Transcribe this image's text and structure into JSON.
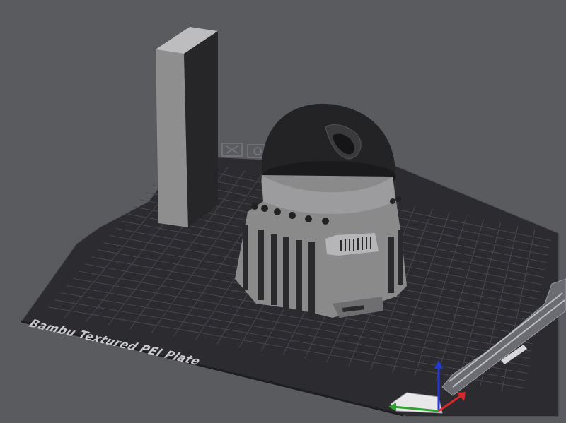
{
  "viewport": {
    "background_color": "#5a5b5f",
    "plate": {
      "label": "Bambu Textured PEI Plate",
      "plate_color": "#2c2c30",
      "grid_color": "#46474c",
      "edge_color": "#6b6c72",
      "label_color": "#c9c9cc"
    },
    "objects": [
      {
        "name": "wipe-tower",
        "color": "#8e8e8e"
      },
      {
        "name": "domed-enclosure",
        "color": "#8a8a8a",
        "dome_color": "#232325"
      }
    ],
    "axes": {
      "x_color": "#d62a2a",
      "y_color": "#2ea42e",
      "z_color": "#2438d8"
    },
    "icons": [
      "plate-close-icon",
      "plate-settings-icon",
      "axes-gizmo-icon"
    ]
  }
}
